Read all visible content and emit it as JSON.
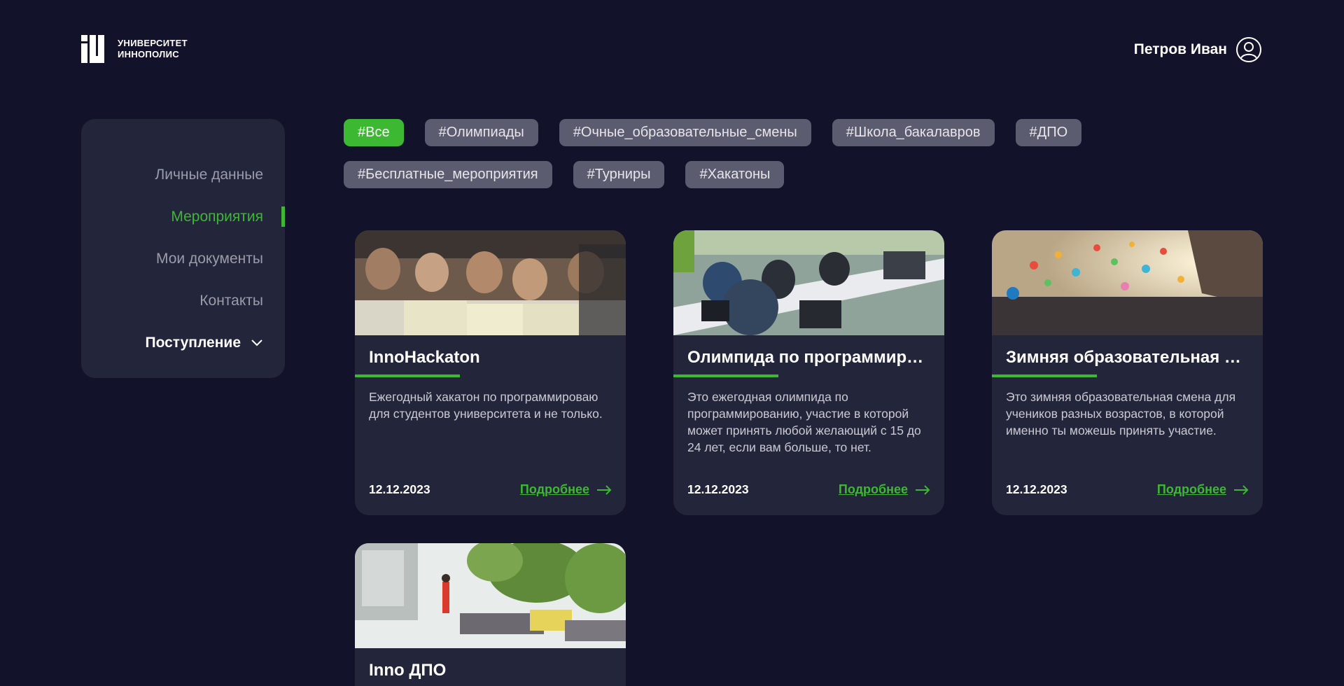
{
  "header": {
    "logo_line1": "УНИВЕРСИТЕТ",
    "logo_line2": "ИННОПОЛИС",
    "user_name": "Петров Иван",
    "user_icon": "user-circle-icon"
  },
  "sidebar": {
    "items": [
      {
        "label": "Личные данные"
      },
      {
        "label": "Мероприятия"
      },
      {
        "label": "Мои документы"
      },
      {
        "label": "Контакты"
      },
      {
        "label": "Поступление"
      }
    ]
  },
  "tags": {
    "row1": [
      "#Все",
      "#Олимпиады",
      "#Очные_образовательные_смены",
      "#Школа_бакалавров",
      "#ДПО"
    ],
    "row2": [
      "#Бесплатные_мероприятия",
      "#Турниры",
      "#Хакатоны"
    ]
  },
  "cards": [
    {
      "title": "InnoHackaton",
      "desc": "Ежегодный хакатон по программироваю для студентов университета и не только.",
      "date": "12.12.2023",
      "link": "Подробнее"
    },
    {
      "title": "Олимпида по программированию",
      "desc": "Это ежегодная олимпида по программированию, участие в которой может принять любой желающий с 15 до 24 лет, если вам больше, то нет.",
      "date": "12.12.2023",
      "link": "Подробнее"
    },
    {
      "title": "Зимняя образовательная смена",
      "desc": "Это зимняя образовательная смена для учеников разных возрастов, в которой именно ты можешь принять участие.",
      "date": "12.12.2023",
      "link": "Подробнее"
    },
    {
      "title": "Inno ДПО",
      "desc": "",
      "date": "",
      "link": ""
    }
  ],
  "colors": {
    "background": "#12132a",
    "panel": "#23253a",
    "accent": "#3db832",
    "tag": "#5b5c6f"
  }
}
